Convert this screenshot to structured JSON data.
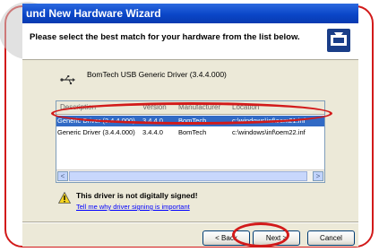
{
  "window": {
    "title": "und New Hardware Wizard"
  },
  "header": {
    "prompt": "Please select the best match for your hardware from the list below."
  },
  "device": {
    "name": "BomTech USB Generic Driver (3.4.4.000)"
  },
  "driver_list": {
    "columns": [
      "Description",
      "Version",
      "Manufacturer",
      "Location"
    ],
    "rows": [
      {
        "description": "Generic Driver (3.4.4.000)",
        "version": "3.4.4.0",
        "manufacturer": "BomTech",
        "location": "c:\\windows\\inf\\oem21.inf",
        "selected": true
      },
      {
        "description": "Generic Driver (3.4.4.000)",
        "version": "3.4.4.0",
        "manufacturer": "BomTech",
        "location": "c:\\windows\\inf\\oem22.inf",
        "selected": false
      }
    ],
    "scroll_left": "<",
    "scroll_right": ">"
  },
  "warning": {
    "title": "This driver is not digitally signed!",
    "link": "Tell me why driver signing is important"
  },
  "buttons": {
    "back": "< Back",
    "next": "Next >",
    "cancel": "Cancel"
  },
  "colors": {
    "annotation_red": "#d21a1a",
    "title_blue": "#0a46c8",
    "selection_blue": "#316ac5",
    "dialog_bg": "#ece9d8"
  }
}
